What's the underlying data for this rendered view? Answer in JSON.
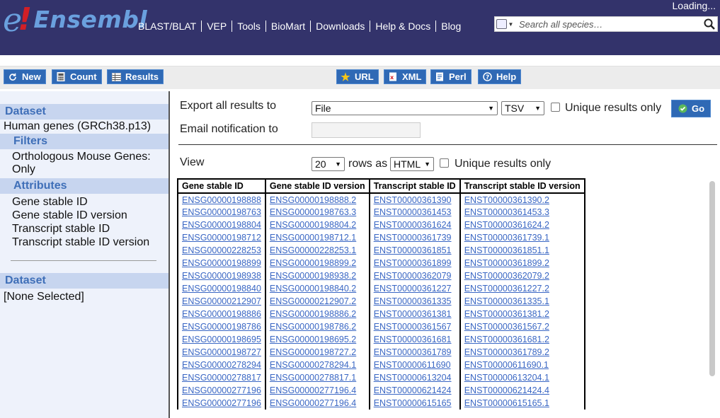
{
  "header": {
    "logo_e": "e",
    "logo_bang": "!",
    "logo_text": "Ensembl",
    "nav": [
      "BLAST/BLAT",
      "VEP",
      "Tools",
      "BioMart",
      "Downloads",
      "Help & Docs",
      "Blog"
    ],
    "loading": "Loading...",
    "search_placeholder": "Search all species…",
    "bg_color": "#33336b"
  },
  "toolbar": {
    "new_label": "New",
    "count_label": "Count",
    "results_label": "Results",
    "url_label": "URL",
    "xml_label": "XML",
    "perl_label": "Perl",
    "help_label": "Help"
  },
  "sidebar": {
    "dataset1_title": "Dataset",
    "dataset1_name": "Human genes (GRCh38.p13)",
    "filters_title": "Filters",
    "filter_line1": "Orthologous Mouse Genes:",
    "filter_line2": "Only",
    "attributes_title": "Attributes",
    "attributes": [
      "Gene stable ID",
      "Gene stable ID version",
      "Transcript stable ID",
      "Transcript stable ID version"
    ],
    "dataset2_title": "Dataset",
    "dataset2_name": "[None Selected]"
  },
  "export": {
    "export_label": "Export  all results to",
    "dest_value": "File",
    "format_value": "TSV",
    "unique_label": "Unique results only",
    "go_label": "Go",
    "email_label": "Email notification to",
    "view_label": "View",
    "rows_value": "20",
    "rows_as_label": "rows as",
    "view_format": "HTML",
    "view_unique_label": "Unique results only"
  },
  "results": {
    "columns": [
      "Gene stable ID",
      "Gene stable ID version",
      "Transcript stable ID",
      "Transcript stable ID version"
    ],
    "rows": [
      [
        "ENSG00000198888",
        "ENSG00000198888.2",
        "ENST00000361390",
        "ENST00000361390.2"
      ],
      [
        "ENSG00000198763",
        "ENSG00000198763.3",
        "ENST00000361453",
        "ENST00000361453.3"
      ],
      [
        "ENSG00000198804",
        "ENSG00000198804.2",
        "ENST00000361624",
        "ENST00000361624.2"
      ],
      [
        "ENSG00000198712",
        "ENSG00000198712.1",
        "ENST00000361739",
        "ENST00000361739.1"
      ],
      [
        "ENSG00000228253",
        "ENSG00000228253.1",
        "ENST00000361851",
        "ENST00000361851.1"
      ],
      [
        "ENSG00000198899",
        "ENSG00000198899.2",
        "ENST00000361899",
        "ENST00000361899.2"
      ],
      [
        "ENSG00000198938",
        "ENSG00000198938.2",
        "ENST00000362079",
        "ENST00000362079.2"
      ],
      [
        "ENSG00000198840",
        "ENSG00000198840.2",
        "ENST00000361227",
        "ENST00000361227.2"
      ],
      [
        "ENSG00000212907",
        "ENSG00000212907.2",
        "ENST00000361335",
        "ENST00000361335.1"
      ],
      [
        "ENSG00000198886",
        "ENSG00000198886.2",
        "ENST00000361381",
        "ENST00000361381.2"
      ],
      [
        "ENSG00000198786",
        "ENSG00000198786.2",
        "ENST00000361567",
        "ENST00000361567.2"
      ],
      [
        "ENSG00000198695",
        "ENSG00000198695.2",
        "ENST00000361681",
        "ENST00000361681.2"
      ],
      [
        "ENSG00000198727",
        "ENSG00000198727.2",
        "ENST00000361789",
        "ENST00000361789.2"
      ],
      [
        "ENSG00000278294",
        "ENSG00000278294.1",
        "ENST00000611690",
        "ENST00000611690.1"
      ],
      [
        "ENSG00000278817",
        "ENSG00000278817.1",
        "ENST00000613204",
        "ENST00000613204.1"
      ],
      [
        "ENSG00000277196",
        "ENSG00000277196.4",
        "ENST00000621424",
        "ENST00000621424.4"
      ],
      [
        "ENSG00000277196",
        "ENSG00000277196.4",
        "ENST00000615165",
        "ENST00000615165.1"
      ]
    ]
  }
}
